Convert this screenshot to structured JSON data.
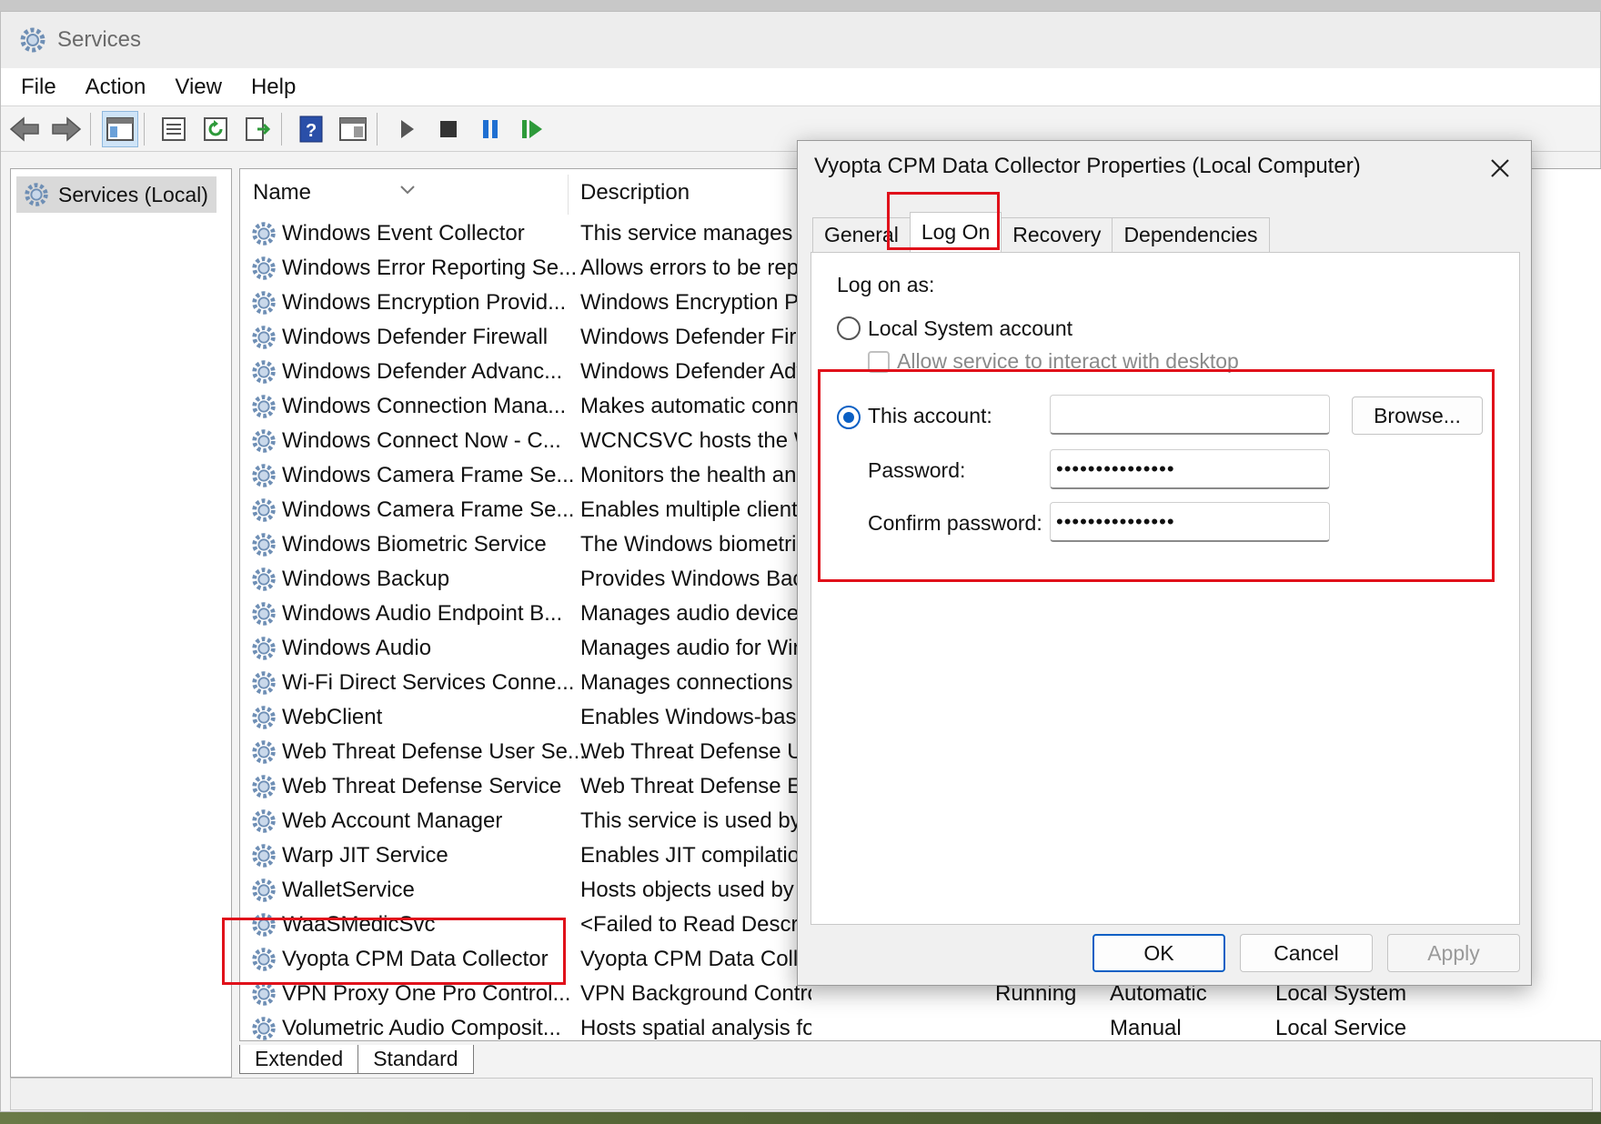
{
  "window": {
    "title": "Services"
  },
  "menu": [
    "File",
    "Action",
    "View",
    "Help"
  ],
  "toolbar_icons": [
    "back-arrow-icon",
    "forward-arrow-icon",
    "show-hide-tree-icon",
    "properties-icon",
    "refresh-icon",
    "export-list-icon",
    "help-icon",
    "console-view-icon",
    "start-service-icon",
    "stop-service-icon",
    "pause-service-icon",
    "resume-service-icon"
  ],
  "tree": {
    "root": "Services (Local)"
  },
  "columns": {
    "name": "Name",
    "description": "Description"
  },
  "services": [
    {
      "name": "Windows Event Collector",
      "desc": "This service manages p"
    },
    {
      "name": "Windows Error Reporting Se...",
      "desc": "Allows errors to be repo"
    },
    {
      "name": "Windows Encryption Provid...",
      "desc": "Windows Encryption P"
    },
    {
      "name": "Windows Defender Firewall",
      "desc": "Windows Defender Fire"
    },
    {
      "name": "Windows Defender Advanc...",
      "desc": "Windows Defender Adv"
    },
    {
      "name": "Windows Connection Mana...",
      "desc": "Makes automatic conn"
    },
    {
      "name": "Windows Connect Now - C...",
      "desc": "WCNCSVC hosts the W"
    },
    {
      "name": "Windows Camera Frame Se...",
      "desc": "Monitors the health an"
    },
    {
      "name": "Windows Camera Frame Se...",
      "desc": "Enables multiple client"
    },
    {
      "name": "Windows Biometric Service",
      "desc": "The Windows biometri"
    },
    {
      "name": "Windows Backup",
      "desc": "Provides Windows Bac"
    },
    {
      "name": "Windows Audio Endpoint B...",
      "desc": "Manages audio devices"
    },
    {
      "name": "Windows Audio",
      "desc": "Manages audio for Win"
    },
    {
      "name": "Wi-Fi Direct Services Conne...",
      "desc": "Manages connections t"
    },
    {
      "name": "WebClient",
      "desc": "Enables Windows-base"
    },
    {
      "name": "Web Threat Defense User Se...",
      "desc": "Web Threat Defense Us"
    },
    {
      "name": "Web Threat Defense Service",
      "desc": "Web Threat Defense En"
    },
    {
      "name": "Web Account Manager",
      "desc": "This service is used by"
    },
    {
      "name": "Warp JIT Service",
      "desc": "Enables JIT compilation"
    },
    {
      "name": "WalletService",
      "desc": "Hosts objects used by c"
    },
    {
      "name": "WaaSMedicSvc",
      "desc": "<Failed to Read Descrip"
    },
    {
      "name": "Vyopta CPM Data Collector",
      "desc": "Vyopta CPM Data Colle"
    },
    {
      "name": "VPN Proxy One Pro Control...",
      "desc": "VPN Background Controller",
      "status": "Running",
      "startup": "Automatic",
      "logon": "Local System"
    },
    {
      "name": "Volumetric Audio Composit...",
      "desc": "Hosts spatial analysis for Mixed Reality...",
      "status": "",
      "startup": "Manual",
      "logon": "Local Service"
    }
  ],
  "bottom_tabs": [
    "Extended",
    "Standard"
  ],
  "dialog": {
    "title": "Vyopta CPM Data Collector Properties (Local Computer)",
    "tabs": [
      "General",
      "Log On",
      "Recovery",
      "Dependencies"
    ],
    "selected_tab": "Log On",
    "log_on_as": "Log on as:",
    "local_system": "Local System account",
    "allow_interact": "Allow service to interact with desktop",
    "this_account": "This account:",
    "account_value": "",
    "password_label": "Password:",
    "password_value": "•••••••••••••••",
    "confirm_label": "Confirm password:",
    "confirm_value": "•••••••••••••••",
    "browse": "Browse...",
    "ok": "OK",
    "cancel": "Cancel",
    "apply": "Apply"
  },
  "colors": {
    "highlight": "#e0101a",
    "accent": "#0a5fc4"
  }
}
